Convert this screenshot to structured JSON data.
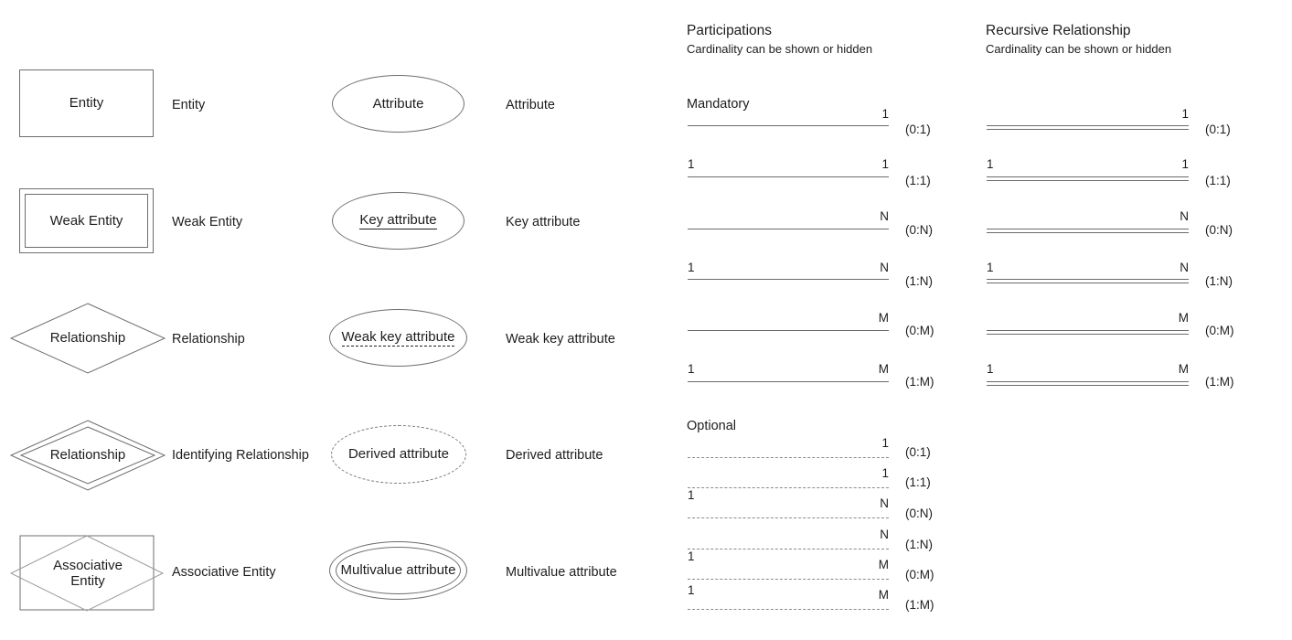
{
  "entity_shapes": [
    {
      "shape": "rectangle",
      "inner_text": "Entity",
      "label": "Entity"
    },
    {
      "shape": "double-rectangle",
      "inner_text": "Weak Entity",
      "label": "Weak Entity"
    },
    {
      "shape": "diamond",
      "inner_text": "Relationship",
      "label": "Relationship"
    },
    {
      "shape": "double-diamond",
      "inner_text": "Relationship",
      "label": "Identifying Relationship"
    },
    {
      "shape": "rectangle-diamond",
      "inner_text": "Associative\nEntity",
      "label": "Associative Entity"
    }
  ],
  "attribute_shapes": [
    {
      "shape": "ellipse",
      "inner_text": "Attribute",
      "underline": "none",
      "label": "Attribute"
    },
    {
      "shape": "ellipse",
      "inner_text": "Key attribute",
      "underline": "solid",
      "label": "Key attribute"
    },
    {
      "shape": "ellipse",
      "inner_text": "Weak key attribute",
      "underline": "dashed",
      "label": "Weak key attribute"
    },
    {
      "shape": "dashed-ellipse",
      "inner_text": "Derived attribute",
      "underline": "none",
      "label": "Derived attribute"
    },
    {
      "shape": "double-ellipse",
      "inner_text": "Multivalue attribute",
      "underline": "none",
      "label": "Multivalue attribute"
    }
  ],
  "participations": {
    "title": "Participations",
    "subtitle": "Cardinality can be shown or hidden",
    "mandatory_label": "Mandatory",
    "optional_label": "Optional",
    "mandatory": [
      {
        "left": "",
        "right": "1",
        "cardinality": "(0:1)"
      },
      {
        "left": "1",
        "right": "1",
        "cardinality": "(1:1)"
      },
      {
        "left": "",
        "right": "N",
        "cardinality": "(0:N)"
      },
      {
        "left": "1",
        "right": "N",
        "cardinality": "(1:N)"
      },
      {
        "left": "",
        "right": "M",
        "cardinality": "(0:M)"
      },
      {
        "left": "1",
        "right": "M",
        "cardinality": "(1:M)"
      }
    ],
    "optional": [
      {
        "left": "",
        "right": "1",
        "cardinality": "(0:1)"
      },
      {
        "left": "",
        "right": "1",
        "cardinality": "(1:1)"
      },
      {
        "left": "1",
        "right": "N",
        "cardinality": "(0:N)"
      },
      {
        "left": "",
        "right": "N",
        "cardinality": "(1:N)"
      },
      {
        "left": "1",
        "right": "M",
        "cardinality": "(0:M)"
      },
      {
        "left": "1",
        "right": "M",
        "cardinality": "(1:M)"
      }
    ]
  },
  "recursive": {
    "title": "Recursive Relationship",
    "subtitle": "Cardinality can be shown or hidden",
    "rows": [
      {
        "left": "",
        "right": "1",
        "cardinality": "(0:1)"
      },
      {
        "left": "1",
        "right": "1",
        "cardinality": "(1:1)"
      },
      {
        "left": "",
        "right": "N",
        "cardinality": "(0:N)"
      },
      {
        "left": "1",
        "right": "N",
        "cardinality": "(1:N)"
      },
      {
        "left": "",
        "right": "M",
        "cardinality": "(0:M)"
      },
      {
        "left": "1",
        "right": "M",
        "cardinality": "(1:M)"
      }
    ]
  },
  "colors": {
    "stroke": "#6e6e6e",
    "text": "#1d1d1d",
    "background": "#ffffff"
  }
}
